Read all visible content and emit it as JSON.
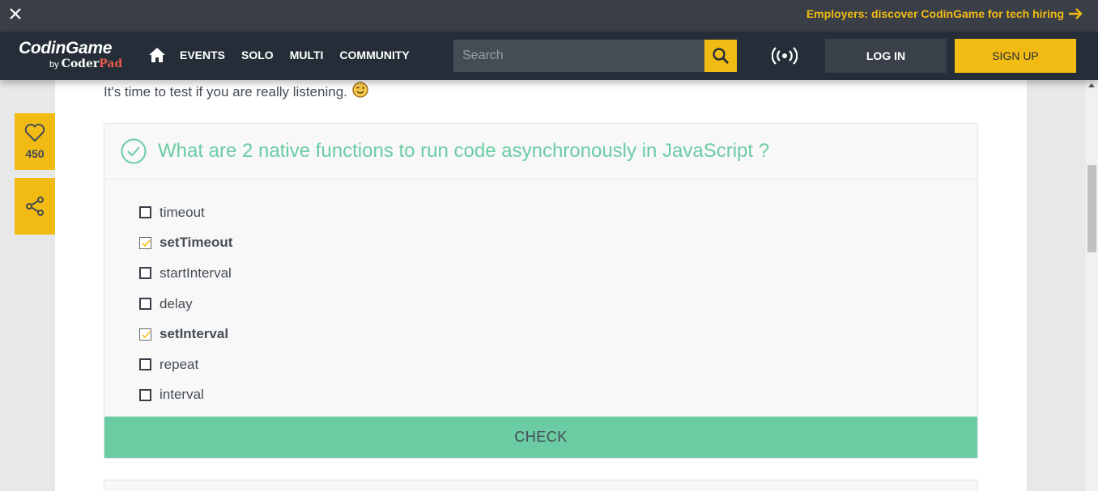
{
  "banner": {
    "close_icon": "close-icon",
    "employers_text": "Employers: discover CodinGame for tech hiring",
    "arrow_icon": "arrow-right-icon"
  },
  "nav": {
    "logo_main": "CodinGame",
    "logo_by": "by",
    "logo_coder": "Coder",
    "logo_pad": "Pad",
    "home_icon": "home-icon",
    "menu": [
      "EVENTS",
      "SOLO",
      "MULTI",
      "COMMUNITY"
    ],
    "search_placeholder": "Search",
    "search_icon": "search-icon",
    "live_icon": "broadcast-icon",
    "login_label": "LOG IN",
    "signup_label": "SIGN UP"
  },
  "side": {
    "like_count": "450",
    "like_icon": "heart-icon",
    "share_icon": "share-icon"
  },
  "content": {
    "intro": "It's time to test if you are really listening.",
    "intro_emoji": "😉",
    "quiz": {
      "question": "What are 2 native functions to run code asynchronously in JavaScript ?",
      "status_icon": "check-circle-icon",
      "options": [
        {
          "label": "timeout",
          "checked": false
        },
        {
          "label": "setTimeout",
          "checked": true
        },
        {
          "label": "startInterval",
          "checked": false
        },
        {
          "label": "delay",
          "checked": false
        },
        {
          "label": "setInterval",
          "checked": true
        },
        {
          "label": "repeat",
          "checked": false
        },
        {
          "label": "interval",
          "checked": false
        }
      ],
      "check_label": "CHECK"
    }
  },
  "colors": {
    "accent": "#f2bb13",
    "success": "#6bcca4",
    "nav_bg": "#252e38"
  }
}
